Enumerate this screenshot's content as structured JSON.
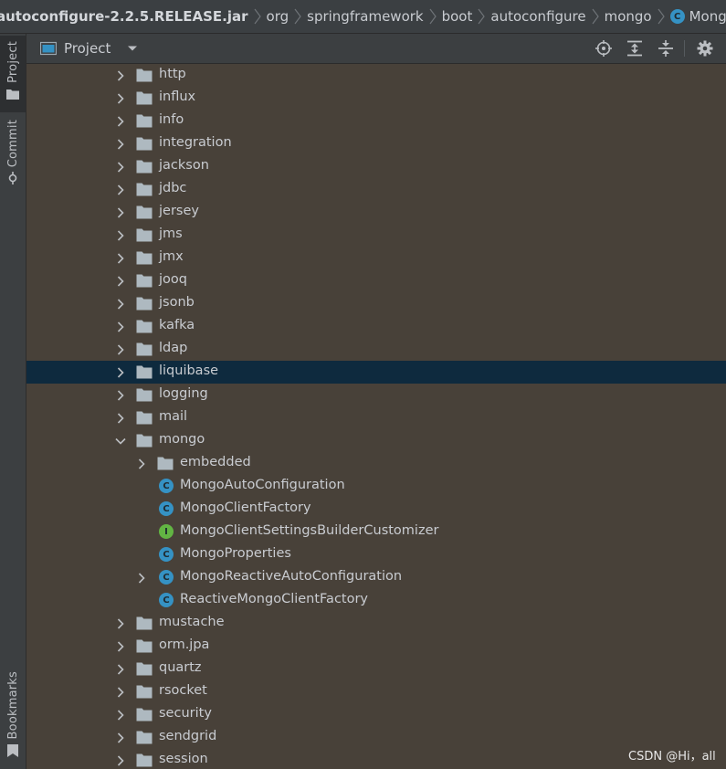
{
  "breadcrumb": {
    "items": [
      "autoconfigure-2.2.5.RELEASE.jar",
      "org",
      "springframework",
      "boot",
      "autoconfigure",
      "mongo"
    ],
    "current": "MongoProperties",
    "current_icon_letter": "C"
  },
  "tool_strip": {
    "project_label": "Project",
    "commit_label": "Commit",
    "bookmarks_label": "Bookmarks"
  },
  "panel": {
    "title": "Project",
    "actions": [
      "locate-icon",
      "expand-all-icon",
      "collapse-all-icon",
      "settings-icon"
    ]
  },
  "tree": {
    "rows": [
      {
        "label": "http",
        "type": "folder",
        "level": 0,
        "arrow": "right",
        "selected": false
      },
      {
        "label": "influx",
        "type": "folder",
        "level": 0,
        "arrow": "right",
        "selected": false
      },
      {
        "label": "info",
        "type": "folder",
        "level": 0,
        "arrow": "right",
        "selected": false
      },
      {
        "label": "integration",
        "type": "folder",
        "level": 0,
        "arrow": "right",
        "selected": false
      },
      {
        "label": "jackson",
        "type": "folder",
        "level": 0,
        "arrow": "right",
        "selected": false
      },
      {
        "label": "jdbc",
        "type": "folder",
        "level": 0,
        "arrow": "right",
        "selected": false
      },
      {
        "label": "jersey",
        "type": "folder",
        "level": 0,
        "arrow": "right",
        "selected": false
      },
      {
        "label": "jms",
        "type": "folder",
        "level": 0,
        "arrow": "right",
        "selected": false
      },
      {
        "label": "jmx",
        "type": "folder",
        "level": 0,
        "arrow": "right",
        "selected": false
      },
      {
        "label": "jooq",
        "type": "folder",
        "level": 0,
        "arrow": "right",
        "selected": false
      },
      {
        "label": "jsonb",
        "type": "folder",
        "level": 0,
        "arrow": "right",
        "selected": false
      },
      {
        "label": "kafka",
        "type": "folder",
        "level": 0,
        "arrow": "right",
        "selected": false
      },
      {
        "label": "ldap",
        "type": "folder",
        "level": 0,
        "arrow": "right",
        "selected": false
      },
      {
        "label": "liquibase",
        "type": "folder",
        "level": 0,
        "arrow": "right",
        "selected": true
      },
      {
        "label": "logging",
        "type": "folder",
        "level": 0,
        "arrow": "right",
        "selected": false
      },
      {
        "label": "mail",
        "type": "folder",
        "level": 0,
        "arrow": "right",
        "selected": false
      },
      {
        "label": "mongo",
        "type": "folder",
        "level": 0,
        "arrow": "down",
        "selected": false
      },
      {
        "label": "embedded",
        "type": "folder",
        "level": 1,
        "arrow": "right",
        "selected": false
      },
      {
        "label": "MongoAutoConfiguration",
        "type": "class",
        "level": 1,
        "arrow": "none",
        "selected": false
      },
      {
        "label": "MongoClientFactory",
        "type": "class",
        "level": 1,
        "arrow": "none",
        "selected": false
      },
      {
        "label": "MongoClientSettingsBuilderCustomizer",
        "type": "interface",
        "level": 1,
        "arrow": "none",
        "selected": false
      },
      {
        "label": "MongoProperties",
        "type": "class",
        "level": 1,
        "arrow": "none",
        "selected": false
      },
      {
        "label": "MongoReactiveAutoConfiguration",
        "type": "class",
        "level": 1,
        "arrow": "right",
        "selected": false
      },
      {
        "label": "ReactiveMongoClientFactory",
        "type": "class",
        "level": 1,
        "arrow": "none",
        "selected": false
      },
      {
        "label": "mustache",
        "type": "folder",
        "level": 0,
        "arrow": "right",
        "selected": false
      },
      {
        "label": "orm.jpa",
        "type": "folder",
        "level": 0,
        "arrow": "right",
        "selected": false
      },
      {
        "label": "quartz",
        "type": "folder",
        "level": 0,
        "arrow": "right",
        "selected": false
      },
      {
        "label": "rsocket",
        "type": "folder",
        "level": 0,
        "arrow": "right",
        "selected": false
      },
      {
        "label": "security",
        "type": "folder",
        "level": 0,
        "arrow": "right",
        "selected": false
      },
      {
        "label": "sendgrid",
        "type": "folder",
        "level": 0,
        "arrow": "right",
        "selected": false
      },
      {
        "label": "session",
        "type": "folder",
        "level": 0,
        "arrow": "right",
        "selected": false
      }
    ],
    "icon_letters": {
      "class": "C",
      "interface": "I"
    }
  },
  "watermark": "CSDN @Hi，all",
  "colors": {
    "tree_background": "#484139",
    "selection": "#0e2a3e",
    "class_icon": "#3592c4",
    "interface_icon": "#62b543",
    "folder_icon": "#aeb9c0"
  }
}
